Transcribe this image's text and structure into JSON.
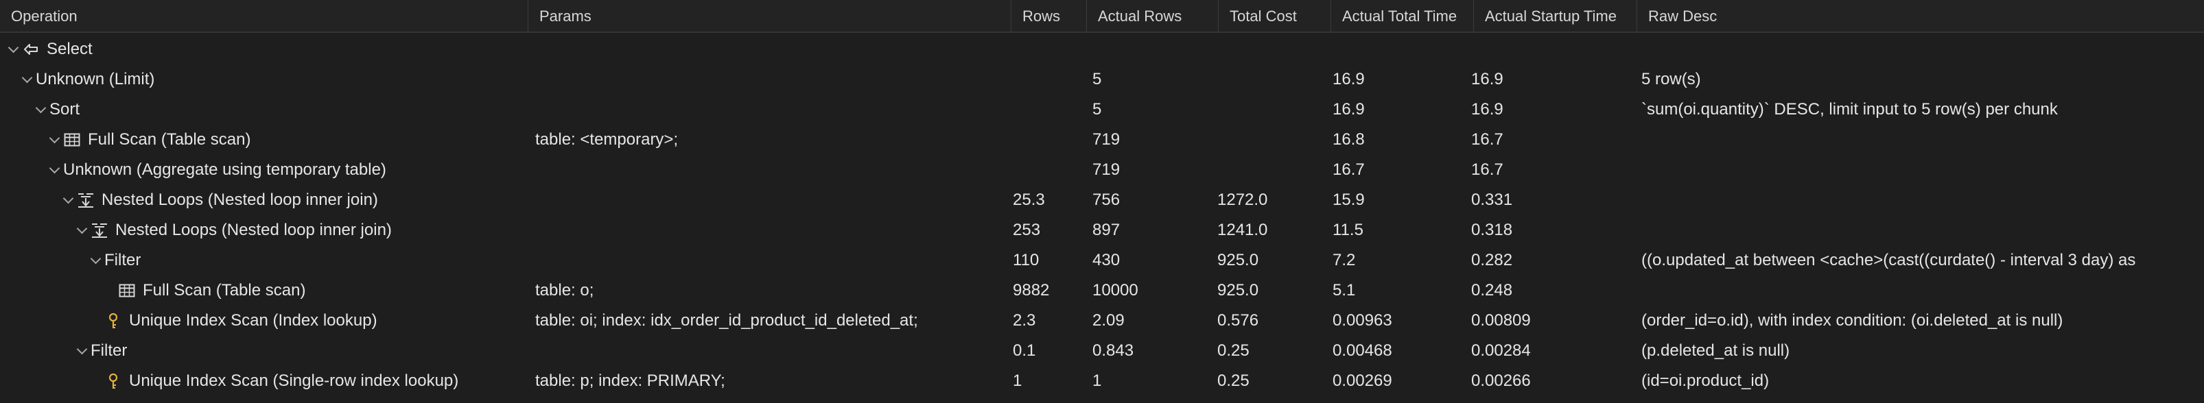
{
  "columns": [
    "Operation",
    "Params",
    "Rows",
    "Actual Rows",
    "Total Cost",
    "Actual Total Time",
    "Actual Startup Time",
    "Raw Desc"
  ],
  "rows": [
    {
      "op": "Select",
      "icon": "arrow-left-icon",
      "params": "",
      "rows": "",
      "actual_rows": "",
      "total_cost": "",
      "actual_total_time": "",
      "actual_startup_time": "",
      "raw_desc": ""
    },
    {
      "op": "Unknown (Limit)",
      "icon": "",
      "params": "",
      "rows": "",
      "actual_rows": "5",
      "total_cost": "",
      "actual_total_time": "16.9",
      "actual_startup_time": "16.9",
      "raw_desc": "5 row(s)"
    },
    {
      "op": "Sort",
      "icon": "",
      "params": "",
      "rows": "",
      "actual_rows": "5",
      "total_cost": "",
      "actual_total_time": "16.9",
      "actual_startup_time": "16.9",
      "raw_desc": "`sum(oi.quantity)` DESC, limit input to 5 row(s) per chunk"
    },
    {
      "op": "Full Scan (Table scan)",
      "icon": "table-icon",
      "params": "table: <temporary>;",
      "rows": "",
      "actual_rows": "719",
      "total_cost": "",
      "actual_total_time": "16.8",
      "actual_startup_time": "16.7",
      "raw_desc": ""
    },
    {
      "op": "Unknown (Aggregate using temporary table)",
      "icon": "",
      "params": "",
      "rows": "",
      "actual_rows": "719",
      "total_cost": "",
      "actual_total_time": "16.7",
      "actual_startup_time": "16.7",
      "raw_desc": ""
    },
    {
      "op": "Nested Loops (Nested loop inner join)",
      "icon": "nested-loop-icon",
      "params": "",
      "rows": "25.3",
      "actual_rows": "756",
      "total_cost": "1272.0",
      "actual_total_time": "15.9",
      "actual_startup_time": "0.331",
      "raw_desc": ""
    },
    {
      "op": "Nested Loops (Nested loop inner join)",
      "icon": "nested-loop-icon",
      "params": "",
      "rows": "253",
      "actual_rows": "897",
      "total_cost": "1241.0",
      "actual_total_time": "11.5",
      "actual_startup_time": "0.318",
      "raw_desc": ""
    },
    {
      "op": "Filter",
      "icon": "",
      "params": "",
      "rows": "110",
      "actual_rows": "430",
      "total_cost": "925.0",
      "actual_total_time": "7.2",
      "actual_startup_time": "0.282",
      "raw_desc": "((o.updated_at between <cache>(cast((curdate() - interval 3 day) as"
    },
    {
      "op": "Full Scan (Table scan)",
      "icon": "table-icon",
      "params": "table: o;",
      "rows": "9882",
      "actual_rows": "10000",
      "total_cost": "925.0",
      "actual_total_time": "5.1",
      "actual_startup_time": "0.248",
      "raw_desc": ""
    },
    {
      "op": "Unique Index Scan (Index lookup)",
      "icon": "key-icon",
      "params": "table: oi; index: idx_order_id_product_id_deleted_at;",
      "rows": "2.3",
      "actual_rows": "2.09",
      "total_cost": "0.576",
      "actual_total_time": "0.00963",
      "actual_startup_time": "0.00809",
      "raw_desc": "(order_id=o.id), with index condition: (oi.deleted_at is null)"
    },
    {
      "op": "Filter",
      "icon": "",
      "params": "",
      "rows": "0.1",
      "actual_rows": "0.843",
      "total_cost": "0.25",
      "actual_total_time": "0.00468",
      "actual_startup_time": "0.00284",
      "raw_desc": "(p.deleted_at is null)"
    },
    {
      "op": "Unique Index Scan (Single-row index lookup)",
      "icon": "key-icon",
      "params": "table: p; index: PRIMARY;",
      "rows": "1",
      "actual_rows": "1",
      "total_cost": "0.25",
      "actual_total_time": "0.00269",
      "actual_startup_time": "0.00266",
      "raw_desc": "(id=oi.product_id)"
    }
  ],
  "colors": {
    "background": "#1e1e1e",
    "header_background": "#232323",
    "text": "#e6e6e6",
    "accent_key": "#e2b33c"
  }
}
